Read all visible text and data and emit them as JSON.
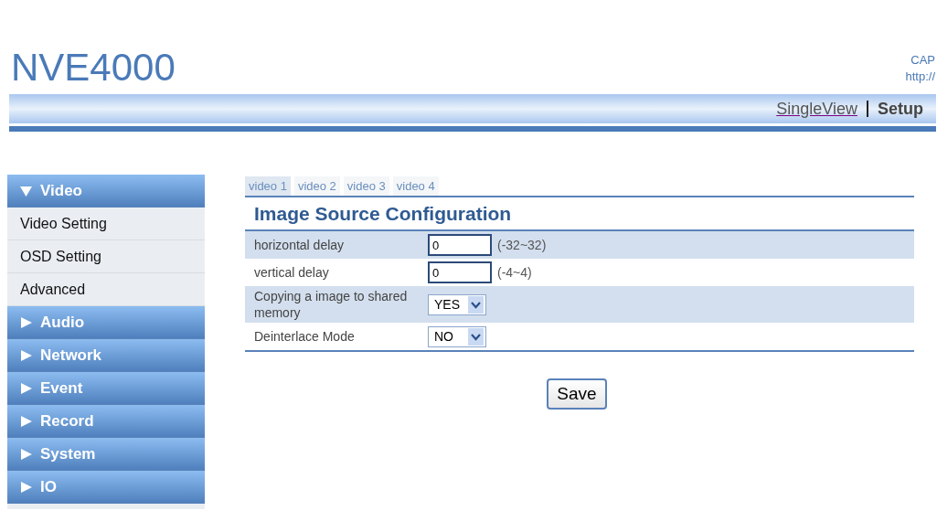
{
  "header": {
    "logo": "NVE4000",
    "info_lines": [
      "CAP",
      "http://"
    ]
  },
  "nav": [
    {
      "label": "SingleView",
      "selected": false
    },
    {
      "label": "Setup",
      "selected": true
    }
  ],
  "sidebar": [
    {
      "label": "Video",
      "expanded": true,
      "children": [
        {
          "label": "Video Setting"
        },
        {
          "label": "OSD Setting"
        },
        {
          "label": "Advanced"
        }
      ]
    },
    {
      "label": "Audio",
      "expanded": false
    },
    {
      "label": "Network",
      "expanded": false
    },
    {
      "label": "Event",
      "expanded": false
    },
    {
      "label": "Record",
      "expanded": false
    },
    {
      "label": "System",
      "expanded": false
    },
    {
      "label": "IO",
      "expanded": false
    }
  ],
  "tabs": [
    {
      "label": "video 1",
      "selected": true
    },
    {
      "label": "video 2",
      "selected": false
    },
    {
      "label": "video 3",
      "selected": false
    },
    {
      "label": "video 4",
      "selected": false
    }
  ],
  "title": "Image Source Configuration",
  "rows": [
    {
      "kind": "input",
      "label": "horizontal delay",
      "value": "0",
      "range": "(-32~32)"
    },
    {
      "kind": "input",
      "label": "vertical delay",
      "value": "0",
      "range": "(-4~4)"
    },
    {
      "kind": "select",
      "label": "Copying a image to shared memory",
      "value": "YES"
    },
    {
      "kind": "select",
      "label": "Deinterlace Mode",
      "value": "NO"
    }
  ],
  "save_button": "Save"
}
